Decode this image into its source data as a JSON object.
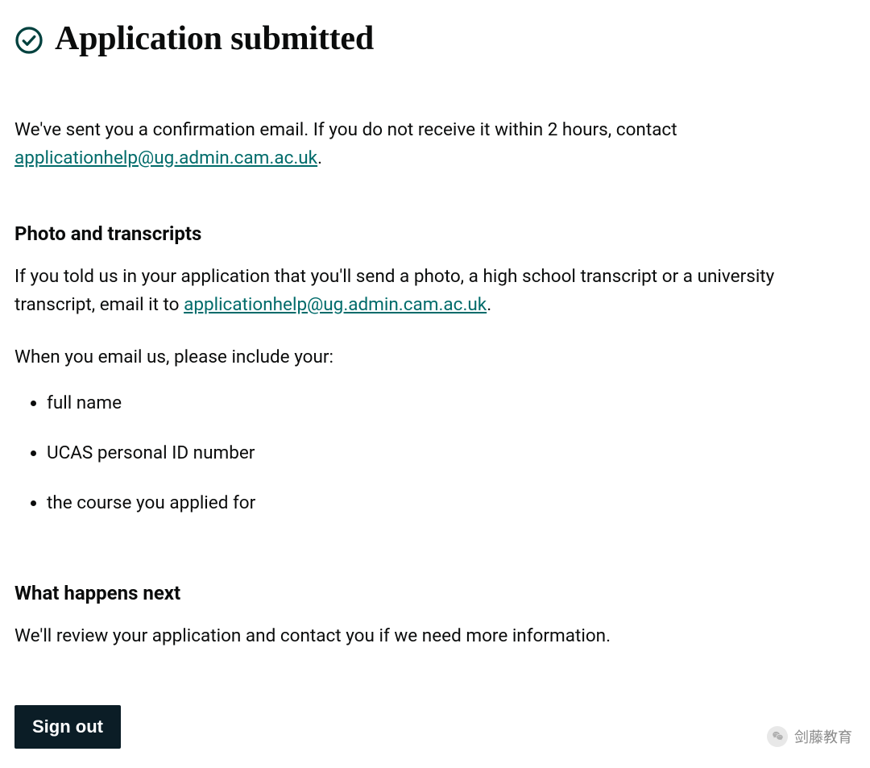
{
  "header": {
    "title": "Application submitted"
  },
  "intro": {
    "text": "We've sent you a confirmation email. If you do not receive it within 2 hours, contact ",
    "email": "applicationhelp@ug.admin.cam.ac.uk"
  },
  "section1": {
    "heading": "Photo and transcripts",
    "para1": "If you told us in your application that you'll send a photo, a high school transcript or a university transcript, email it to ",
    "email": "applicationhelp@ug.admin.cam.ac.uk",
    "para2": "When you email us, please include your:",
    "bullets": [
      "full name",
      "UCAS personal ID number",
      "the course you applied for"
    ]
  },
  "section2": {
    "heading": "What happens next",
    "para": "We'll review your application and contact you if we need more information."
  },
  "actions": {
    "signout": "Sign out"
  },
  "watermark": {
    "text": "剑藤教育"
  }
}
